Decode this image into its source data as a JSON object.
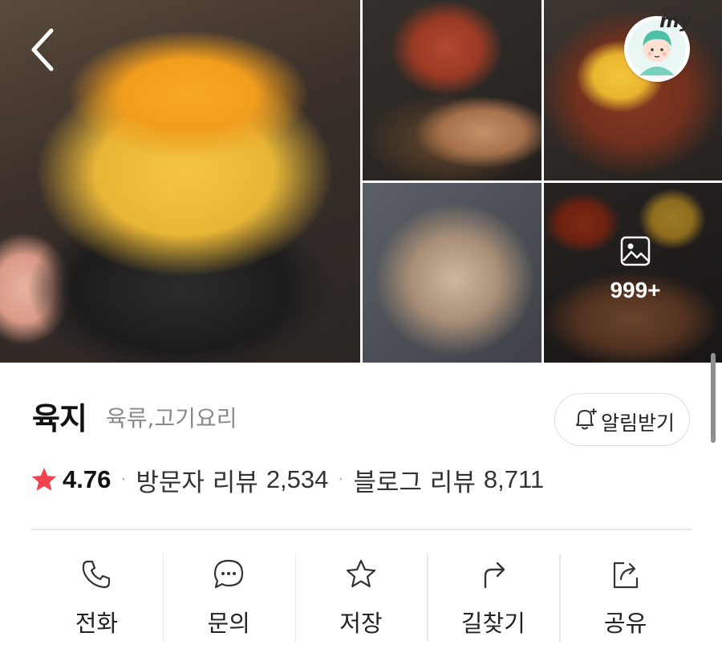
{
  "gallery": {
    "photos": [
      "cheese-egg-bowl",
      "noodles-and-pork-rolls",
      "cheese-fondue-pork",
      "grilled-meat-tray",
      "stew-and-meat-spread"
    ],
    "more_count": "999+",
    "my_badge": "my"
  },
  "place": {
    "name": "육지",
    "category": "육류,고기요리"
  },
  "notify": {
    "label": "알림받기"
  },
  "stats": {
    "rating": "4.76",
    "visitor_review_label": "방문자 리뷰",
    "visitor_review_count": "2,534",
    "blog_review_label": "블로그 리뷰",
    "blog_review_count": "8,711",
    "separator": "·"
  },
  "actions": [
    {
      "label": "전화",
      "icon": "phone-icon"
    },
    {
      "label": "문의",
      "icon": "chat-icon"
    },
    {
      "label": "저장",
      "icon": "star-outline-icon"
    },
    {
      "label": "길찾기",
      "icon": "directions-icon"
    },
    {
      "label": "공유",
      "icon": "share-icon"
    }
  ],
  "colors": {
    "star": "#f0454d",
    "text_primary": "#111111",
    "text_muted": "#8a8a8a",
    "divider": "#e6e6e6"
  }
}
